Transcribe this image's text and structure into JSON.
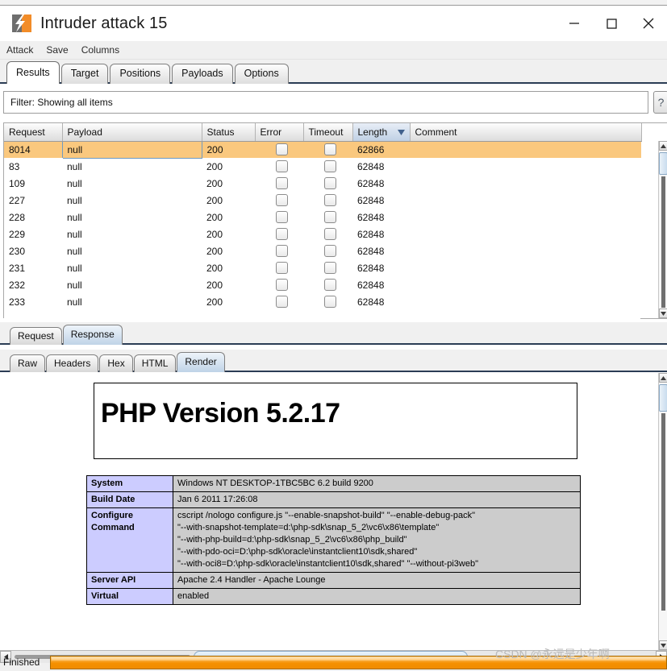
{
  "window": {
    "title": "Intruder attack 15",
    "app_icon": "intruder-bolt-icon",
    "minimize_label": "Minimize",
    "maximize_label": "Maximize",
    "close_label": "Close"
  },
  "menubar": {
    "items": [
      {
        "label": "Attack"
      },
      {
        "label": "Save"
      },
      {
        "label": "Columns"
      }
    ]
  },
  "tabs": {
    "items": [
      {
        "label": "Results",
        "active": true
      },
      {
        "label": "Target",
        "active": false
      },
      {
        "label": "Positions",
        "active": false
      },
      {
        "label": "Payloads",
        "active": false
      },
      {
        "label": "Options",
        "active": false
      }
    ]
  },
  "filter": {
    "text": "Filter: Showing all items",
    "help_label": "?"
  },
  "results_table": {
    "columns": [
      {
        "label": "Request",
        "sorted": false
      },
      {
        "label": "Payload",
        "sorted": false
      },
      {
        "label": "Status",
        "sorted": false
      },
      {
        "label": "Error",
        "sorted": false
      },
      {
        "label": "Timeout",
        "sorted": false
      },
      {
        "label": "Length",
        "sorted": true,
        "sort_dir": "desc"
      },
      {
        "label": "Comment",
        "sorted": false
      }
    ],
    "rows": [
      {
        "request": "8014",
        "payload": "null",
        "status": "200",
        "error": false,
        "timeout": false,
        "length": "62866",
        "comment": "",
        "selected": true
      },
      {
        "request": "83",
        "payload": "null",
        "status": "200",
        "error": false,
        "timeout": false,
        "length": "62848",
        "comment": "",
        "selected": false
      },
      {
        "request": "109",
        "payload": "null",
        "status": "200",
        "error": false,
        "timeout": false,
        "length": "62848",
        "comment": "",
        "selected": false
      },
      {
        "request": "227",
        "payload": "null",
        "status": "200",
        "error": false,
        "timeout": false,
        "length": "62848",
        "comment": "",
        "selected": false
      },
      {
        "request": "228",
        "payload": "null",
        "status": "200",
        "error": false,
        "timeout": false,
        "length": "62848",
        "comment": "",
        "selected": false
      },
      {
        "request": "229",
        "payload": "null",
        "status": "200",
        "error": false,
        "timeout": false,
        "length": "62848",
        "comment": "",
        "selected": false
      },
      {
        "request": "230",
        "payload": "null",
        "status": "200",
        "error": false,
        "timeout": false,
        "length": "62848",
        "comment": "",
        "selected": false
      },
      {
        "request": "231",
        "payload": "null",
        "status": "200",
        "error": false,
        "timeout": false,
        "length": "62848",
        "comment": "",
        "selected": false
      },
      {
        "request": "232",
        "payload": "null",
        "status": "200",
        "error": false,
        "timeout": false,
        "length": "62848",
        "comment": "",
        "selected": false
      },
      {
        "request": "233",
        "payload": "null",
        "status": "200",
        "error": false,
        "timeout": false,
        "length": "62848",
        "comment": "",
        "selected": false
      }
    ]
  },
  "message_tabs": {
    "items": [
      {
        "label": "Request",
        "active": false
      },
      {
        "label": "Response",
        "active": true
      }
    ]
  },
  "view_tabs": {
    "items": [
      {
        "label": "Raw",
        "active": false
      },
      {
        "label": "Headers",
        "active": false
      },
      {
        "label": "Hex",
        "active": false
      },
      {
        "label": "HTML",
        "active": false
      },
      {
        "label": "Render",
        "active": true
      }
    ]
  },
  "phpinfo": {
    "version_heading": "PHP Version 5.2.17",
    "rows": [
      {
        "key": "System",
        "lines": [
          "Windows NT DESKTOP-1TBC5BC 6.2 build 9200"
        ]
      },
      {
        "key": "Build Date",
        "lines": [
          "Jan 6 2011 17:26:08"
        ]
      },
      {
        "key": "Configure Command",
        "lines": [
          "cscript /nologo configure.js \"--enable-snapshot-build\" \"--enable-debug-pack\"",
          "\"--with-snapshot-template=d:\\php-sdk\\snap_5_2\\vc6\\x86\\template\"",
          "\"--with-php-build=d:\\php-sdk\\snap_5_2\\vc6\\x86\\php_build\"",
          "\"--with-pdo-oci=D:\\php-sdk\\oracle\\instantclient10\\sdk,shared\"",
          "\"--with-oci8=D:\\php-sdk\\oracle\\instantclient10\\sdk,shared\" \"--without-pi3web\""
        ]
      },
      {
        "key": "Server API",
        "lines": [
          "Apache 2.4 Handler - Apache Lounge"
        ]
      },
      {
        "key": "Virtual",
        "lines": [
          "enabled"
        ]
      }
    ]
  },
  "statusbar": {
    "text": "Finished",
    "progress_percent": 100
  },
  "watermark": {
    "text": "CSDN @永远是少年啊"
  },
  "colors": {
    "selection_orange": "#fac87e",
    "progress_orange": "#f59000",
    "sorted_header_blue": "#bfd0e4",
    "phpinfo_key": "#ccccff",
    "phpinfo_value": "#cccccc",
    "tab_underline": "#2b3d55"
  }
}
